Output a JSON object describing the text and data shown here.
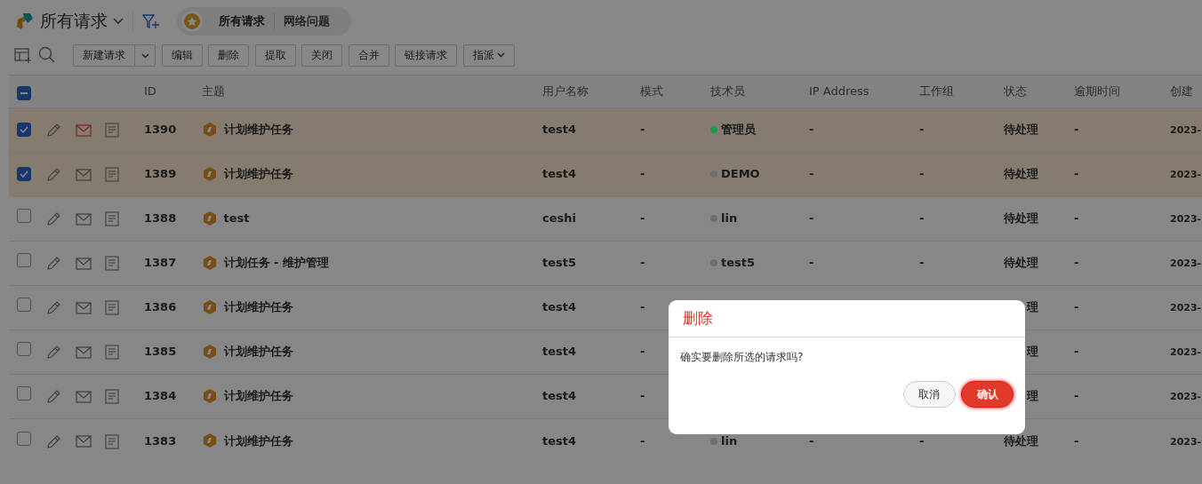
{
  "header": {
    "title": "所有请求",
    "tabs": [
      {
        "label": "所有请求",
        "selected": true
      },
      {
        "label": "网络问题",
        "selected": false
      }
    ]
  },
  "toolbar": {
    "buttons": [
      {
        "label": "新建请求",
        "kind": "split"
      },
      {
        "label": "编辑",
        "kind": "plain"
      },
      {
        "label": "删除",
        "kind": "plain"
      },
      {
        "label": "提取",
        "kind": "plain"
      },
      {
        "label": "关闭",
        "kind": "plain"
      },
      {
        "label": "合并",
        "kind": "plain"
      },
      {
        "label": "链接请求",
        "kind": "plain"
      },
      {
        "label": "指派",
        "kind": "menu"
      }
    ]
  },
  "table": {
    "indeterminate": true,
    "columns": [
      "ID",
      "主题",
      "用户名称",
      "模式",
      "技术员",
      "IP Address",
      "工作组",
      "状态",
      "逾期时间",
      "创建"
    ],
    "rows": [
      {
        "selected": true,
        "mail_flagged": true,
        "id": "1390",
        "subject": "计划维护任务",
        "user": "test4",
        "mode": "-",
        "tech": {
          "name": "管理员",
          "color": "#1f9a52"
        },
        "ip": "-",
        "group": "-",
        "status": "待处理",
        "due": "-",
        "created": "2023-"
      },
      {
        "selected": true,
        "mail_flagged": false,
        "id": "1389",
        "subject": "计划维护任务",
        "user": "test4",
        "mode": "-",
        "tech": {
          "name": "DEMO",
          "color": "#6e6e6e"
        },
        "ip": "-",
        "group": "-",
        "status": "待处理",
        "due": "-",
        "created": "2023-"
      },
      {
        "selected": false,
        "mail_flagged": false,
        "id": "1388",
        "subject": "test",
        "user": "ceshi",
        "mode": "-",
        "tech": {
          "name": "lin",
          "color": "#6e6e6e"
        },
        "ip": "-",
        "group": "-",
        "status": "待处理",
        "due": "-",
        "created": "2023-"
      },
      {
        "selected": false,
        "mail_flagged": false,
        "id": "1387",
        "subject": "计划任务 - 维护管理",
        "user": "test5",
        "mode": "-",
        "tech": {
          "name": "test5",
          "color": "#6e6e6e"
        },
        "ip": "-",
        "group": "-",
        "status": "待处理",
        "due": "-",
        "created": "2023-"
      },
      {
        "selected": false,
        "mail_flagged": false,
        "id": "1386",
        "subject": "计划维护任务",
        "user": "test4",
        "mode": "-",
        "status": "理",
        "due": "-",
        "created": "2023-"
      },
      {
        "selected": false,
        "mail_flagged": false,
        "id": "1385",
        "subject": "计划维护任务",
        "user": "test4",
        "mode": "-",
        "status": "理",
        "due": "-",
        "created": "2023-"
      },
      {
        "selected": false,
        "mail_flagged": false,
        "id": "1384",
        "subject": "计划维护任务",
        "user": "test4",
        "mode": "-",
        "status": "理",
        "due": "-",
        "created": "2023-"
      },
      {
        "selected": false,
        "mail_flagged": false,
        "id": "1383",
        "subject": "计划维护任务",
        "user": "test4",
        "mode": "-",
        "tech": {
          "name": "lin",
          "color": "#6e6e6e"
        },
        "ip": "-",
        "group": "-",
        "status": "待处理",
        "due": "-",
        "created": "2023-"
      }
    ]
  },
  "dialog": {
    "title": "删除",
    "message": "确实要删除所选的请求吗?",
    "buttons": [
      {
        "label": "取消",
        "kind": "cancel"
      },
      {
        "label": "确认",
        "kind": "confirm"
      }
    ]
  }
}
